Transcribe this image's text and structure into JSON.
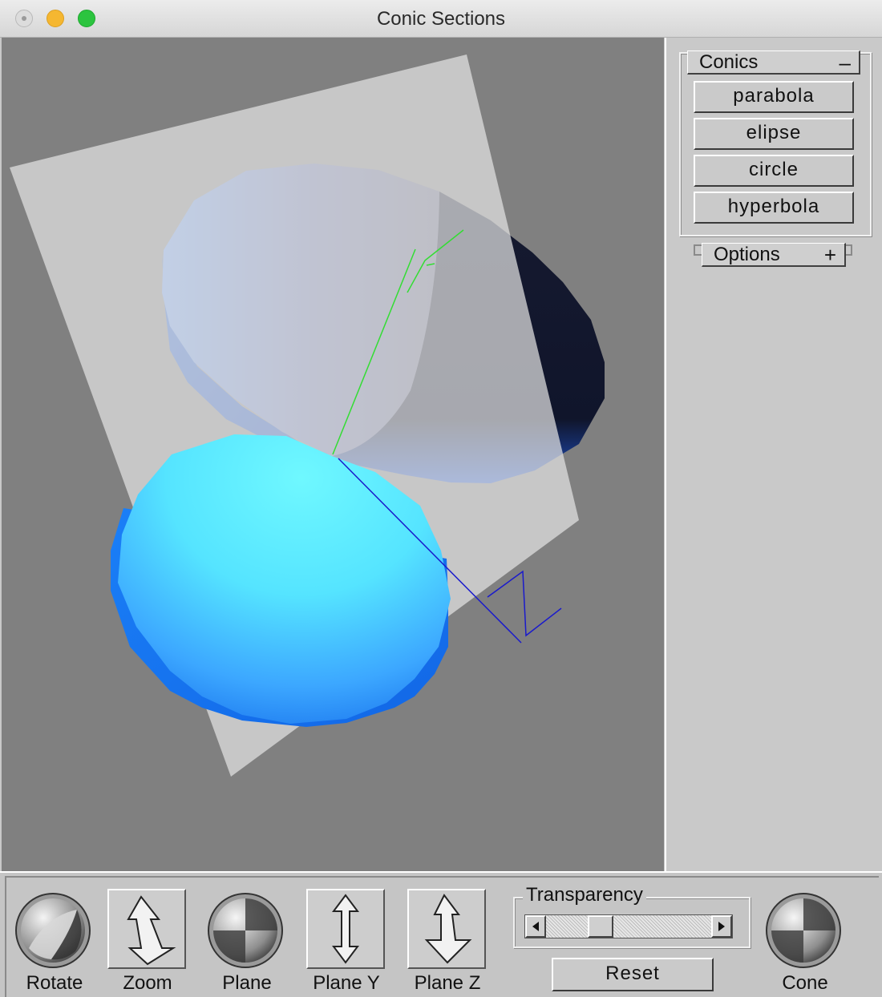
{
  "window": {
    "title": "Conic Sections"
  },
  "scene": {
    "axis_y_label": "Y",
    "axis_z_label": "Z",
    "colors": {
      "background": "#808080",
      "plane": "#d3d3d3",
      "axis_y": "#33dd33",
      "axis_z": "#1a1acc"
    }
  },
  "panel": {
    "conics": {
      "title": "Conics",
      "toggle": "–",
      "buttons": [
        "parabola",
        "elipse",
        "circle",
        "hyperbola"
      ]
    },
    "options": {
      "title": "Options",
      "toggle": "+"
    }
  },
  "toolbar": {
    "rotate": "Rotate",
    "zoom": "Zoom",
    "plane": "Plane",
    "plane_y": "Plane Y",
    "plane_z": "Plane Z",
    "transparency": {
      "label": "Transparency",
      "value": 0.3
    },
    "reset": "Reset",
    "cone": "Cone"
  }
}
